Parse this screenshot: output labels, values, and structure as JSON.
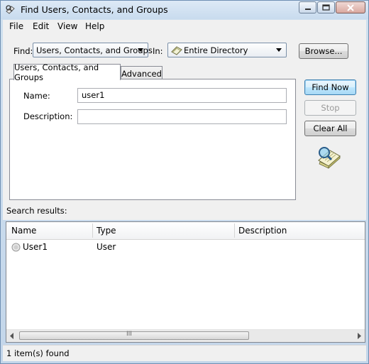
{
  "window": {
    "title": "Find Users, Contacts, and Groups"
  },
  "menubar": {
    "items": [
      "File",
      "Edit",
      "View",
      "Help"
    ]
  },
  "find": {
    "find_label": "Find:",
    "find_value": "Users, Contacts, and Groups",
    "in_label": "In:",
    "in_value": "Entire Directory",
    "browse_label": "Browse..."
  },
  "tabs": [
    "Users, Contacts, and Groups",
    "Advanced"
  ],
  "form": {
    "name_label": "Name:",
    "name_value": "user1",
    "description_label": "Description:",
    "description_value": ""
  },
  "buttons": {
    "find_now": "Find Now",
    "stop": "Stop",
    "clear_all": "Clear All"
  },
  "results": {
    "label": "Search results:",
    "columns": [
      "Name",
      "Type",
      "Description"
    ],
    "rows": [
      {
        "name": "User1",
        "type": "User",
        "description": ""
      }
    ]
  },
  "status": {
    "text": "1 item(s) found"
  },
  "scrollbar": {
    "grip": "III"
  },
  "colors": {
    "accent": "#3c7fb1",
    "title_bg": "#cfe0ef"
  }
}
